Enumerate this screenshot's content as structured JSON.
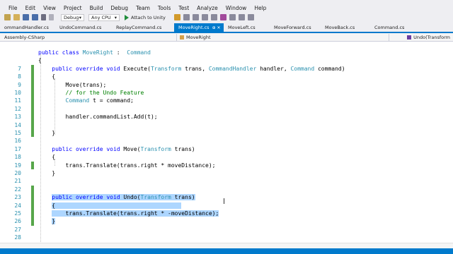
{
  "menu": [
    "File",
    "Edit",
    "View",
    "Project",
    "Build",
    "Debug",
    "Team",
    "Tools",
    "Test",
    "Analyze",
    "Window",
    "Help"
  ],
  "toolbar": {
    "config": "Debug",
    "platform": "Any CPU",
    "run_label": "Attach to Unity"
  },
  "tabs": [
    {
      "label": "ommandHandler.cs",
      "active": false
    },
    {
      "label": "UndoCommand.cs",
      "active": false
    },
    {
      "label": "ReplayCommand.cs",
      "active": false
    },
    {
      "label": "MoveRight.cs",
      "active": true,
      "pin": "⊕ ✕"
    },
    {
      "label": "MoveLeft.cs",
      "active": false
    },
    {
      "label": "MoveForward.cs",
      "active": false
    },
    {
      "label": "MoveBack.cs",
      "active": false
    },
    {
      "label": "Command.cs",
      "active": false
    }
  ],
  "nav": {
    "project": "Assembly-CSharp",
    "class": "MoveRight",
    "member": "Undo(Transform"
  },
  "code_lines": [
    {
      "n": "",
      "html": "<span class='kw'>public class</span> <span class='ty'>MoveRight</span> :  <span class='ty'>Command</span>"
    },
    {
      "n": "",
      "html": "{"
    },
    {
      "n": "7",
      "html": "    <span class='kw'>public override void</span> Execute(<span class='ty'>Transform</span> trans, <span class='ty'>CommandHandler</span> handler, <span class='ty'>Command</span> command)"
    },
    {
      "n": "8",
      "html": "    {"
    },
    {
      "n": "9",
      "html": "        Move(trans);"
    },
    {
      "n": "10",
      "html": "        <span class='cm'>// for the Undo Feature</span>"
    },
    {
      "n": "11",
      "html": "        <span class='ty'>Command</span> t = command;"
    },
    {
      "n": "12",
      "html": ""
    },
    {
      "n": "13",
      "html": "        handler.commandList.Add(t);"
    },
    {
      "n": "14",
      "html": ""
    },
    {
      "n": "15",
      "html": "    }"
    },
    {
      "n": "16",
      "html": ""
    },
    {
      "n": "17",
      "html": "    <span class='kw'>public override void</span> Move(<span class='ty'>Transform</span> trans)"
    },
    {
      "n": "18",
      "html": "    {"
    },
    {
      "n": "19",
      "html": "        trans.Translate(trans.right * moveDistance);"
    },
    {
      "n": "20",
      "html": "    }"
    },
    {
      "n": "21",
      "html": ""
    },
    {
      "n": "22",
      "html": ""
    },
    {
      "n": "23",
      "html": "    <span class='sel'><span class='kw'>public override void</span> Undo(<span class='ty'>Transform</span> trans)</span>"
    },
    {
      "n": "24",
      "html": "    <span class='sel'>{                                     </span>"
    },
    {
      "n": "25",
      "html": "    <span class='sel'>    trans.Translate(trans.right * -moveDistance);</span>"
    },
    {
      "n": "26",
      "html": "    <span class='sel'>}</span>"
    },
    {
      "n": "27",
      "html": ""
    },
    {
      "n": "28",
      "html": ""
    }
  ]
}
